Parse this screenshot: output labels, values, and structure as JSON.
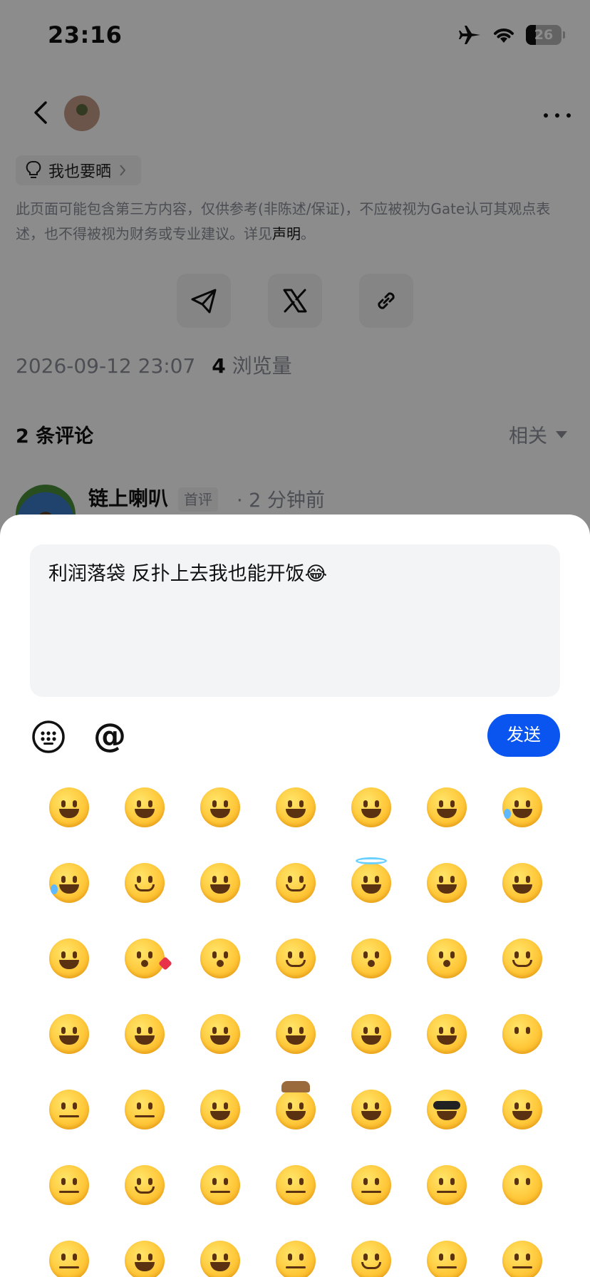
{
  "status_bar": {
    "time": "23:16",
    "battery": "26"
  },
  "post": {
    "share_pill": "我也要晒",
    "disclaimer_text": "此页面可能包含第三方内容，仅供参考(非陈述/保证)，不应被视为Gate认可其观点表述，也不得被视为财务或专业建议。详见",
    "disclaimer_link": "声明",
    "disclaimer_end": "。",
    "date": "2026-09-12 23:07",
    "views_count": "4",
    "views_label": "浏览量"
  },
  "comments": {
    "count_label": "2 条评论",
    "sort_label": "相关",
    "first": {
      "author": "链上喇叭",
      "badge": "首评",
      "time": "· 2 分钟前"
    }
  },
  "composer": {
    "input_value": "利润落袋 反扑上去我也能开饭😂",
    "at_symbol": "@",
    "send_label": "发送"
  },
  "emoji_grid": {
    "rows": [
      [
        "grinning",
        "smiley",
        "smile",
        "grin",
        "laughing",
        "sweat-smile",
        "rofl"
      ],
      [
        "joy",
        "slight-smile",
        "wink",
        "blush",
        "innocent",
        "smiling-hearts",
        "heart-eyes"
      ],
      [
        "star-struck",
        "kissing-heart",
        "kissing",
        "relaxed",
        "kissing-closed-eyes",
        "kissing-smiling-eyes",
        "smirk"
      ],
      [
        "yum",
        "tongue",
        "winking-tongue",
        "zany",
        "squinting-tongue",
        "hugging",
        "hand-over-mouth"
      ],
      [
        "shushing",
        "thinking",
        "drooling",
        "cowboy",
        "partying",
        "sunglasses",
        "nerd"
      ],
      [
        "monocle",
        "upside-down",
        "zipper-mouth",
        "raised-eyebrow",
        "neutral",
        "expressionless",
        "no-mouth"
      ],
      [
        "unamused",
        "rolling-eyes",
        "grimacing",
        "lying",
        "relieved",
        "pensive",
        "sleepy"
      ]
    ]
  }
}
